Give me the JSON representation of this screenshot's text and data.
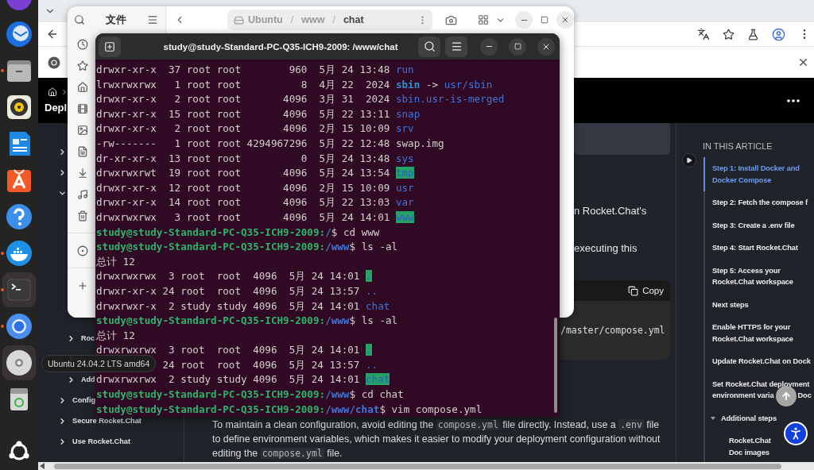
{
  "dock": {
    "items": [
      {
        "kind": "firefox",
        "running": false,
        "highlighted": false
      },
      {
        "kind": "thunderbird",
        "running": false,
        "highlighted": false
      },
      {
        "kind": "files",
        "running": true,
        "highlighted": false
      },
      {
        "kind": "rhythmbox",
        "running": false,
        "highlighted": false
      },
      {
        "kind": "writer",
        "running": false,
        "highlighted": false
      },
      {
        "kind": "appcenter",
        "running": false,
        "highlighted": false
      },
      {
        "kind": "help",
        "running": false,
        "highlighted": false
      },
      {
        "kind": "docker",
        "running": true,
        "highlighted": false
      },
      {
        "kind": "terminal",
        "running": true,
        "highlighted": true
      },
      {
        "kind": "chromium",
        "running": true,
        "highlighted": false
      },
      {
        "kind": "disc",
        "running": false,
        "highlighted": true
      },
      {
        "kind": "trash",
        "running": false,
        "highlighted": false
      }
    ],
    "tooltip": "Ubuntu 24.04.2 LTS amd64"
  },
  "browser": {
    "header": {
      "title": "Depl"
    },
    "nav": [
      {
        "expanded": false
      },
      {
        "expanded": false
      },
      {
        "expanded": true,
        "children": [
          {
            "label": "Roc",
            "expanded": false
          },
          {
            "expanded": false
          },
          {
            "label": "Add",
            "expanded": false
          }
        ]
      },
      {
        "label": "Config",
        "expanded": false
      },
      {
        "label": "Secure Rocket.Chat",
        "expanded": false
      },
      {
        "label": "Use Rocket.Chat",
        "expanded": false
      }
    ],
    "fragments": [
      "n Rocket.Chat's",
      "executing this"
    ],
    "code": {
      "copy": "Copy",
      "text": "/master/compose.yml"
    },
    "paragraph": [
      {
        "text": "To maintain a clean configuration, avoid editing the ",
        "code": false
      },
      {
        "text": "compose.yml",
        "code": true
      },
      {
        "text": " file directly. Instead, use a ",
        "code": false
      },
      {
        "text": ".env",
        "code": true
      },
      {
        "text": " file to define environment variables, which makes it easier to modify your deployment configuration without editing the ",
        "code": false
      },
      {
        "text": "compose.yml",
        "code": true
      },
      {
        "text": " file.",
        "code": false
      }
    ],
    "toc": {
      "title": "IN THIS ARTICLE",
      "items": [
        {
          "label": "Step 1: Install Docker and Docker Compose",
          "selected": true
        },
        {
          "label": "Step 2: Fetch the compose f",
          "selected": false
        },
        {
          "label": "Step 3: Create a .env file",
          "selected": false
        },
        {
          "label": "Step 4: Start Rocket.Chat",
          "selected": false
        },
        {
          "label": "Step 5: Access your Rocket.Chat workspace",
          "selected": false
        },
        {
          "label": "Next steps",
          "selected": false
        },
        {
          "label": "Enable HTTPS for your Rocket.Chat workspace",
          "selected": false
        },
        {
          "label": "Update Rocket.Chat on Dock",
          "selected": false
        },
        {
          "label": "Set Rocket.Chat deployment environment varia",
          "label_after": "Doc",
          "selected": false
        },
        {
          "label": "Additional steps",
          "selected": false,
          "expanded": true,
          "children": [
            {
              "label": "Rocket.Chat Doc images",
              "selected": false
            }
          ]
        }
      ]
    }
  },
  "files_window": {
    "title": "文件",
    "path": [
      {
        "kind": "volume",
        "label": "Ubuntu",
        "current": false
      },
      {
        "kind": "separator",
        "label": "/"
      },
      {
        "kind": "folder",
        "label": "www",
        "current": false
      },
      {
        "kind": "separator",
        "label": "/"
      },
      {
        "kind": "folder",
        "label": "chat",
        "current": true
      }
    ]
  },
  "terminal": {
    "title": "study@study-Standard-PC-Q35-ICH9-2009: /www/chat",
    "lines": [
      {
        "kind": "dir_entry",
        "text": "drwxr-xr-x  37 root root        960  5月 24 13:48 ",
        "name": "run"
      },
      {
        "kind": "link_entry",
        "text": "lrwxrwxrwx   1 root root          8  4月 22  2024 ",
        "name": "sbin",
        "arrow": " -> ",
        "target": "usr/sbin"
      },
      {
        "kind": "dir_entry",
        "text": "drwxr-xr-x   2 root root       4096  3月 31  2024 ",
        "name": "sbin.usr-is-merged"
      },
      {
        "kind": "dir_entry",
        "text": "drwxr-xr-x  15 root root       4096  5月 22 13:11 ",
        "name": "snap"
      },
      {
        "kind": "dir_entry",
        "text": "drwxr-xr-x   2 root root       4096  2月 15 10:09 ",
        "name": "srv"
      },
      {
        "kind": "file_entry",
        "text": "-rw-------   1 root root 4294967296  5月 22 12:48 ",
        "name": "swap.img"
      },
      {
        "kind": "dir_entry",
        "text": "dr-xr-xr-x  13 root root          0  5月 24 13:48 ",
        "name": "sys"
      },
      {
        "kind": "open_dir_entry",
        "text": "drwxrwxrwt  19 root root       4096  5月 24 13:54 ",
        "name": "tmp"
      },
      {
        "kind": "dir_entry",
        "text": "drwxr-xr-x  12 root root       4096  2月 15 10:09 ",
        "name": "usr"
      },
      {
        "kind": "dir_entry",
        "text": "drwxr-xr-x  14 root root       4096  5月 22 13:03 ",
        "name": "var"
      },
      {
        "kind": "open_dir_entry",
        "text": "drwxrwxrwx   3 root root       4096  5月 24 14:01 ",
        "name": "www"
      },
      {
        "kind": "prompt",
        "user": "study@study-Standard-PC-Q35-ICH9-2009:",
        "path": "/",
        "command": "$ cd www"
      },
      {
        "kind": "prompt",
        "user": "study@study-Standard-PC-Q35-ICH9-2009:",
        "path": "/www",
        "command": "$ ls -al"
      },
      {
        "kind": "output",
        "text": "总计 12"
      },
      {
        "kind": "open_dir_entry",
        "text": "drwxrwxrwx  3 root  root  4096  5月 24 14:01 ",
        "name": "."
      },
      {
        "kind": "dir_entry",
        "text": "drwxr-xr-x 24 root  root  4096  5月 24 13:57 ",
        "name": ".."
      },
      {
        "kind": "dir_entry",
        "text": "drwxrwxr-x  2 study study 4096  5月 24 14:01 ",
        "name": "chat"
      },
      {
        "kind": "prompt",
        "user": "study@study-Standard-PC-Q35-ICH9-2009:",
        "path": "/www",
        "command": "$ ls -al"
      },
      {
        "kind": "output",
        "text": "总计 12"
      },
      {
        "kind": "open_dir_entry",
        "text": "drwxrwxrwx  3 root  root  4096  5月 24 14:01 ",
        "name": "."
      },
      {
        "kind": "covered_dir_entry",
        "text": "24 root  root  4096  5月 24 13:57 ",
        "name": ".."
      },
      {
        "kind": "open_dir_entry",
        "text": "drwxrwxrwx  2 study study 4096  5月 24 14:01 ",
        "name": "chat"
      },
      {
        "kind": "prompt",
        "user": "study@study-Standard-PC-Q35-ICH9-2009:",
        "path": "/www",
        "command": "$ cd chat"
      },
      {
        "kind": "prompt",
        "user": "study@study-Standard-PC-Q35-ICH9-2009:",
        "path": "/www/chat",
        "command": "$ vim compose.yml"
      }
    ]
  }
}
